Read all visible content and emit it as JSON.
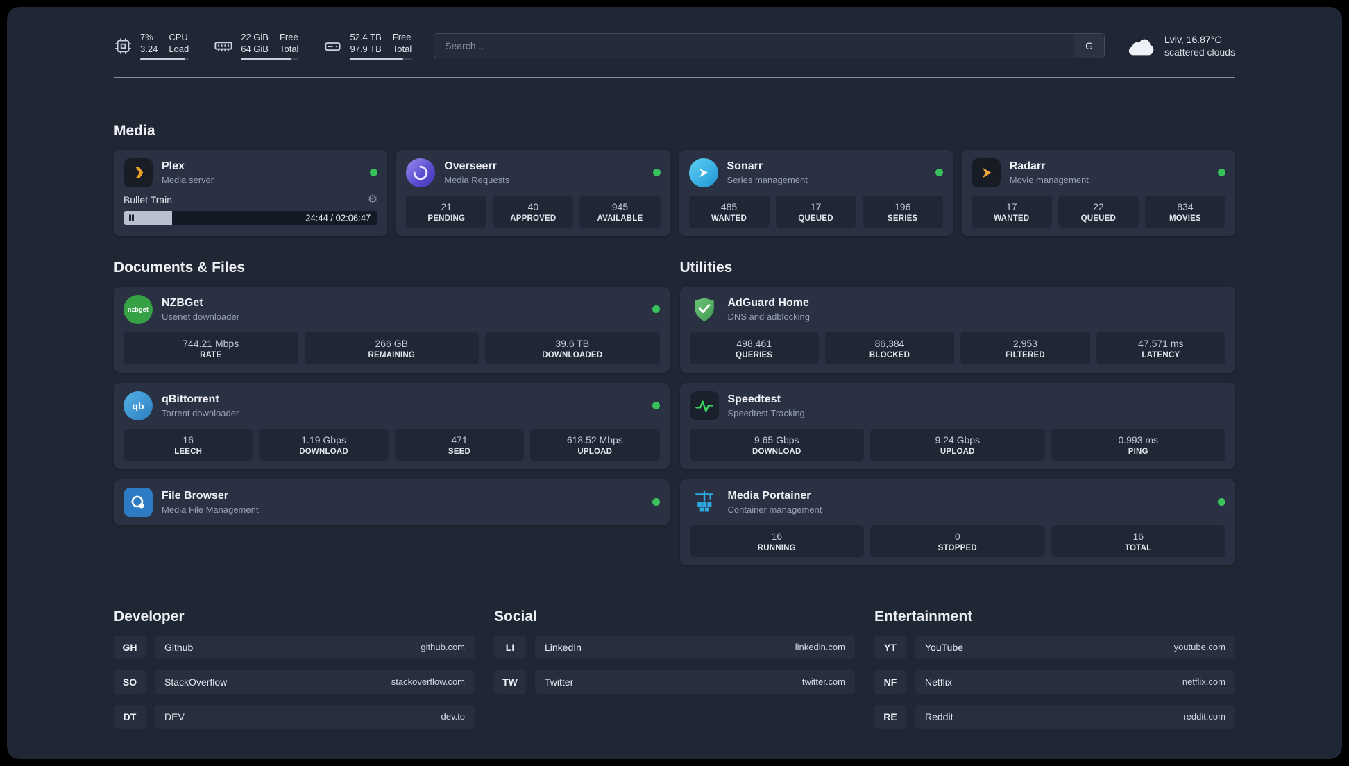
{
  "header": {
    "cpu": {
      "values": [
        "7%",
        "3.24"
      ],
      "labels": [
        "CPU",
        "Load"
      ]
    },
    "memory": {
      "values": [
        "22 GiB",
        "64 GiB"
      ],
      "labels": [
        "Free",
        "Total"
      ]
    },
    "disk": {
      "values": [
        "52.4 TB",
        "97.9 TB"
      ],
      "labels": [
        "Free",
        "Total"
      ]
    },
    "search": {
      "placeholder": "Search...",
      "engine": "G"
    },
    "weather": {
      "location": "Lviv, 16.87°C",
      "condition": "scattered clouds"
    }
  },
  "icons": {
    "gear": "⚙",
    "qb_text": "qb",
    "nzbget_text": "nzbget"
  },
  "sections": {
    "media": {
      "title": "Media",
      "plex": {
        "name": "Plex",
        "desc": "Media server",
        "now_playing": "Bullet Train",
        "time": "24:44 / 02:06:47"
      },
      "overseerr": {
        "name": "Overseerr",
        "desc": "Media Requests",
        "stats": [
          {
            "value": "21",
            "label": "PENDING"
          },
          {
            "value": "40",
            "label": "APPROVED"
          },
          {
            "value": "945",
            "label": "AVAILABLE"
          }
        ]
      },
      "sonarr": {
        "name": "Sonarr",
        "desc": "Series management",
        "stats": [
          {
            "value": "485",
            "label": "WANTED"
          },
          {
            "value": "17",
            "label": "QUEUED"
          },
          {
            "value": "196",
            "label": "SERIES"
          }
        ]
      },
      "radarr": {
        "name": "Radarr",
        "desc": "Movie management",
        "stats": [
          {
            "value": "17",
            "label": "WANTED"
          },
          {
            "value": "22",
            "label": "QUEUED"
          },
          {
            "value": "834",
            "label": "MOVIES"
          }
        ]
      }
    },
    "documents": {
      "title": "Documents & Files",
      "nzbget": {
        "name": "NZBGet",
        "desc": "Usenet downloader",
        "stats": [
          {
            "value": "744.21 Mbps",
            "label": "RATE"
          },
          {
            "value": "266 GB",
            "label": "REMAINING"
          },
          {
            "value": "39.6 TB",
            "label": "DOWNLOADED"
          }
        ]
      },
      "qbittorrent": {
        "name": "qBittorrent",
        "desc": "Torrent downloader",
        "stats": [
          {
            "value": "16",
            "label": "LEECH"
          },
          {
            "value": "1.19 Gbps",
            "label": "DOWNLOAD"
          },
          {
            "value": "471",
            "label": "SEED"
          },
          {
            "value": "618.52 Mbps",
            "label": "UPLOAD"
          }
        ]
      },
      "filebrowser": {
        "name": "File Browser",
        "desc": "Media File Management"
      }
    },
    "utilities": {
      "title": "Utilities",
      "adguard": {
        "name": "AdGuard Home",
        "desc": "DNS and adblocking",
        "stats": [
          {
            "value": "498,461",
            "label": "QUERIES"
          },
          {
            "value": "86,384",
            "label": "BLOCKED"
          },
          {
            "value": "2,953",
            "label": "FILTERED"
          },
          {
            "value": "47.571 ms",
            "label": "LATENCY"
          }
        ]
      },
      "speedtest": {
        "name": "Speedtest",
        "desc": "Speedtest Tracking",
        "stats": [
          {
            "value": "9.65 Gbps",
            "label": "DOWNLOAD"
          },
          {
            "value": "9.24 Gbps",
            "label": "UPLOAD"
          },
          {
            "value": "0.993 ms",
            "label": "PING"
          }
        ]
      },
      "portainer": {
        "name": "Media Portainer",
        "desc": "Container management",
        "stats": [
          {
            "value": "16",
            "label": "RUNNING"
          },
          {
            "value": "0",
            "label": "STOPPED"
          },
          {
            "value": "16",
            "label": "TOTAL"
          }
        ]
      }
    },
    "bookmarks": {
      "developer": {
        "title": "Developer",
        "items": [
          {
            "abbr": "GH",
            "name": "Github",
            "url": "github.com"
          },
          {
            "abbr": "SO",
            "name": "StackOverflow",
            "url": "stackoverflow.com"
          },
          {
            "abbr": "DT",
            "name": "DEV",
            "url": "dev.to"
          }
        ]
      },
      "social": {
        "title": "Social",
        "items": [
          {
            "abbr": "LI",
            "name": "LinkedIn",
            "url": "linkedin.com"
          },
          {
            "abbr": "TW",
            "name": "Twitter",
            "url": "twitter.com"
          }
        ]
      },
      "entertainment": {
        "title": "Entertainment",
        "items": [
          {
            "abbr": "YT",
            "name": "YouTube",
            "url": "youtube.com"
          },
          {
            "abbr": "NF",
            "name": "Netflix",
            "url": "netflix.com"
          },
          {
            "abbr": "RE",
            "name": "Reddit",
            "url": "reddit.com"
          }
        ]
      }
    }
  },
  "colors": {
    "accent_green": "#39c25c",
    "background": "#202734",
    "card": "#2a3142"
  }
}
